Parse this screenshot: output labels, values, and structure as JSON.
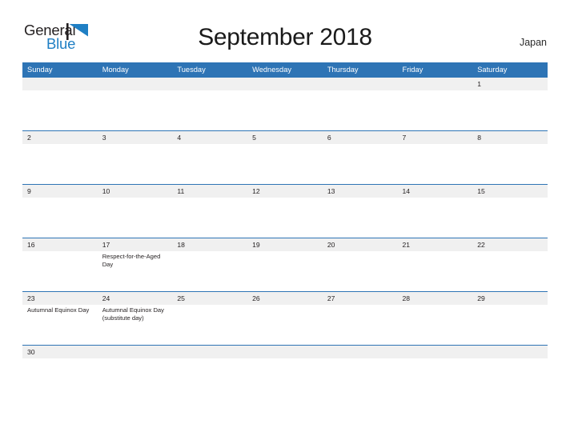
{
  "brand": {
    "name_part1": "General",
    "name_part2": "Blue",
    "flag_icon": "flag-triangle-icon",
    "accent_color": "#1f7fc4",
    "dark_color": "#231f20"
  },
  "header": {
    "title": "September 2018",
    "region": "Japan"
  },
  "theme": {
    "header_blue": "#2e74b5",
    "date_band_gray": "#f0f0f0",
    "page_background": "#ffffff",
    "text_color": "#231f20"
  },
  "calendar": {
    "month": "September",
    "year": "2018",
    "weekday_headers": [
      "Sunday",
      "Monday",
      "Tuesday",
      "Wednesday",
      "Thursday",
      "Friday",
      "Saturday"
    ],
    "weeks": [
      {
        "days": [
          {
            "date": "",
            "events": []
          },
          {
            "date": "",
            "events": []
          },
          {
            "date": "",
            "events": []
          },
          {
            "date": "",
            "events": []
          },
          {
            "date": "",
            "events": []
          },
          {
            "date": "",
            "events": []
          },
          {
            "date": "1",
            "events": []
          }
        ]
      },
      {
        "days": [
          {
            "date": "2",
            "events": []
          },
          {
            "date": "3",
            "events": []
          },
          {
            "date": "4",
            "events": []
          },
          {
            "date": "5",
            "events": []
          },
          {
            "date": "6",
            "events": []
          },
          {
            "date": "7",
            "events": []
          },
          {
            "date": "8",
            "events": []
          }
        ]
      },
      {
        "days": [
          {
            "date": "9",
            "events": []
          },
          {
            "date": "10",
            "events": []
          },
          {
            "date": "11",
            "events": []
          },
          {
            "date": "12",
            "events": []
          },
          {
            "date": "13",
            "events": []
          },
          {
            "date": "14",
            "events": []
          },
          {
            "date": "15",
            "events": []
          }
        ]
      },
      {
        "days": [
          {
            "date": "16",
            "events": []
          },
          {
            "date": "17",
            "events": [
              "Respect-for-the-Aged Day"
            ]
          },
          {
            "date": "18",
            "events": []
          },
          {
            "date": "19",
            "events": []
          },
          {
            "date": "20",
            "events": []
          },
          {
            "date": "21",
            "events": []
          },
          {
            "date": "22",
            "events": []
          }
        ]
      },
      {
        "days": [
          {
            "date": "23",
            "events": [
              "Autumnal Equinox Day"
            ]
          },
          {
            "date": "24",
            "events": [
              "Autumnal Equinox Day (substitute day)"
            ]
          },
          {
            "date": "25",
            "events": []
          },
          {
            "date": "26",
            "events": []
          },
          {
            "date": "27",
            "events": []
          },
          {
            "date": "28",
            "events": []
          },
          {
            "date": "29",
            "events": []
          }
        ]
      },
      {
        "days": [
          {
            "date": "30",
            "events": []
          },
          {
            "date": "",
            "events": []
          },
          {
            "date": "",
            "events": []
          },
          {
            "date": "",
            "events": []
          },
          {
            "date": "",
            "events": []
          },
          {
            "date": "",
            "events": []
          },
          {
            "date": "",
            "events": []
          }
        ]
      }
    ]
  }
}
